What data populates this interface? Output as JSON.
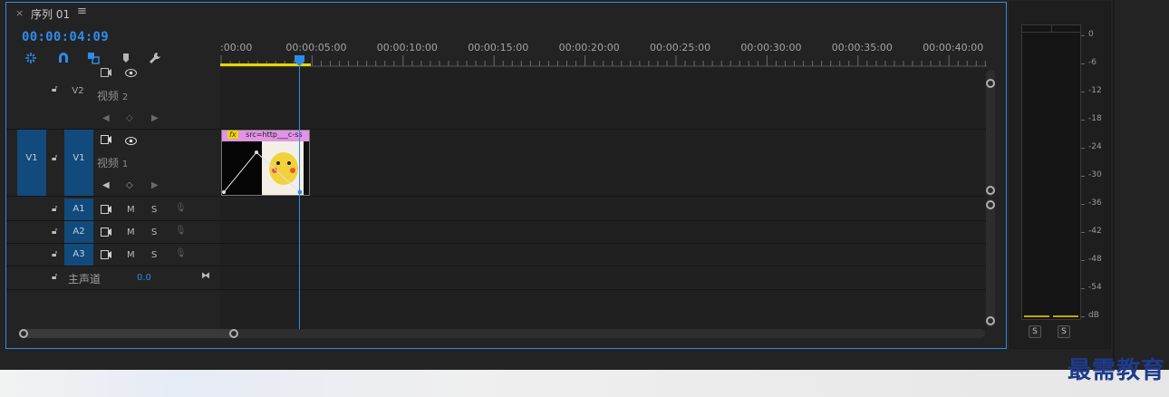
{
  "panel": {
    "close_glyph": "×",
    "title": "序列 01",
    "menu_glyph": "≡",
    "timecode": "00:00:04:09"
  },
  "toolbar": {
    "icons": [
      "insert-sequence-icon",
      "snap-magnet-icon",
      "linked-selection-icon",
      "add-marker-icon",
      "settings-wrench-icon"
    ],
    "accent": "#2d8ceb"
  },
  "ruler": {
    "labels": [
      ":00:00",
      "00:00:05:00",
      "00:00:10:00",
      "00:00:15:00",
      "00:00:20:00",
      "00:00:25:00",
      "00:00:30:00",
      "00:00:35:00",
      "00:00:40:00"
    ]
  },
  "video_tracks": [
    {
      "id": "V2",
      "name": "视频",
      "num": "2"
    },
    {
      "id": "V1",
      "src": "V1",
      "name": "视频",
      "num": "1"
    }
  ],
  "audio_tracks": [
    {
      "id": "A1",
      "m": "M",
      "s": "S"
    },
    {
      "id": "A2",
      "m": "M",
      "s": "S"
    },
    {
      "id": "A3",
      "m": "M",
      "s": "S"
    }
  ],
  "master": {
    "label": "主声道",
    "value": "0.0"
  },
  "clip": {
    "fx": "fx",
    "label": "src=http___c-ss"
  },
  "meter": {
    "scale": [
      "0",
      "-6",
      "-12",
      "-18",
      "-24",
      "-30",
      "-36",
      "-42",
      "-48",
      "-54",
      "dB"
    ],
    "solo_left": "S",
    "solo_right": "S"
  },
  "watermark": "最需教育"
}
